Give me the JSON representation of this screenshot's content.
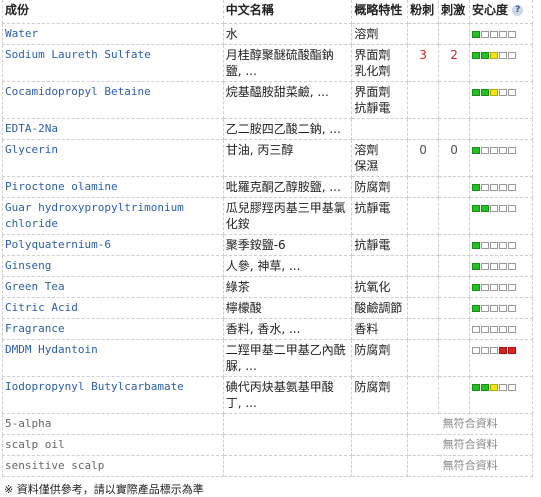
{
  "headers": {
    "ingredient": "成份",
    "chinese_name": "中文名稱",
    "function": "概略特性",
    "acne": "粉刺",
    "irritant": "刺激",
    "safety": "安心度",
    "help_icon": "?"
  },
  "rows": [
    {
      "name": "Water",
      "chinese": "水",
      "func": [
        "溶劑"
      ],
      "acne": "",
      "irr": "",
      "meter": [
        "g",
        "",
        "",
        "",
        ""
      ]
    },
    {
      "name": "Sodium Laureth Sulfate",
      "chinese": "月桂醇聚醚硫酸酯鈉鹽, ...",
      "func": [
        "界面劑",
        "乳化劑"
      ],
      "acne": "3",
      "irr": "2",
      "meter": [
        "g",
        "g",
        "y",
        "",
        ""
      ]
    },
    {
      "name": "Cocamidopropyl Betaine",
      "chinese": "烷基醯胺甜菜鹼, ...",
      "func": [
        "界面劑",
        "抗靜電"
      ],
      "acne": "",
      "irr": "",
      "meter": [
        "g",
        "g",
        "y",
        "",
        ""
      ]
    },
    {
      "name": "EDTA-2Na",
      "chinese": "乙二胺四乙酸二鈉, ...",
      "func": [],
      "acne": "",
      "irr": "",
      "meter": []
    },
    {
      "name": "Glycerin",
      "chinese": "甘油, 丙三醇",
      "func": [
        "溶劑",
        "保濕"
      ],
      "acne": "0",
      "irr": "0",
      "meter": [
        "g",
        "",
        "",
        "",
        ""
      ]
    },
    {
      "name": "Piroctone olamine",
      "chinese": "吡羅克酮乙醇胺鹽, ...",
      "func": [
        "防腐劑"
      ],
      "acne": "",
      "irr": "",
      "meter": [
        "g",
        "",
        "",
        "",
        ""
      ]
    },
    {
      "name": "Guar hydroxypropyltrimonium chloride",
      "chinese": "瓜兒膠羥丙基三甲基氯化銨",
      "func": [
        "抗靜電"
      ],
      "acne": "",
      "irr": "",
      "meter": [
        "g",
        "g",
        "",
        "",
        ""
      ]
    },
    {
      "name": "Polyquaternium-6",
      "chinese": "聚季銨鹽-6",
      "func": [
        "抗靜電"
      ],
      "acne": "",
      "irr": "",
      "meter": [
        "g",
        "",
        "",
        "",
        ""
      ]
    },
    {
      "name": "Ginseng",
      "chinese": "人參, 神草, ...",
      "func": [],
      "acne": "",
      "irr": "",
      "meter": [
        "g",
        "",
        "",
        "",
        ""
      ]
    },
    {
      "name": "Green Tea",
      "chinese": "綠茶",
      "func": [
        "抗氧化"
      ],
      "acne": "",
      "irr": "",
      "meter": [
        "g",
        "",
        "",
        "",
        ""
      ]
    },
    {
      "name": "Citric Acid",
      "chinese": "檸檬酸",
      "func": [
        "酸鹼調節"
      ],
      "acne": "",
      "irr": "",
      "meter": [
        "g",
        "",
        "",
        "",
        ""
      ]
    },
    {
      "name": "Fragrance",
      "chinese": "香料, 香水, ...",
      "func": [
        "香料"
      ],
      "acne": "",
      "irr": "",
      "meter": [
        "",
        "",
        "",
        "",
        ""
      ]
    },
    {
      "name": "DMDM Hydantoin",
      "chinese": "二羥甲基二甲基乙內酰脲, ...",
      "func": [
        "防腐劑"
      ],
      "acne": "",
      "irr": "",
      "meter": [
        "",
        "",
        "",
        "r",
        "r"
      ]
    },
    {
      "name": "Iodopropynyl Butylcarbamate",
      "chinese": "碘代丙炔基氨基甲酸丁, ...",
      "func": [
        "防腐劑"
      ],
      "acne": "",
      "irr": "",
      "meter": [
        "g",
        "g",
        "y",
        "",
        ""
      ]
    },
    {
      "name": "5-alpha",
      "chinese": "",
      "func": [],
      "acne": "",
      "irr": "",
      "meter": [],
      "na": "無符合資料"
    },
    {
      "name": "scalp oil",
      "chinese": "",
      "func": [],
      "acne": "",
      "irr": "",
      "meter": [],
      "na": "無符合資料"
    },
    {
      "name": "sensitive scalp",
      "chinese": "",
      "func": [],
      "acne": "",
      "irr": "",
      "meter": [],
      "na": "無符合資料"
    }
  ],
  "footer": "※ 資料僅供參考，請以實際產品標示為準"
}
